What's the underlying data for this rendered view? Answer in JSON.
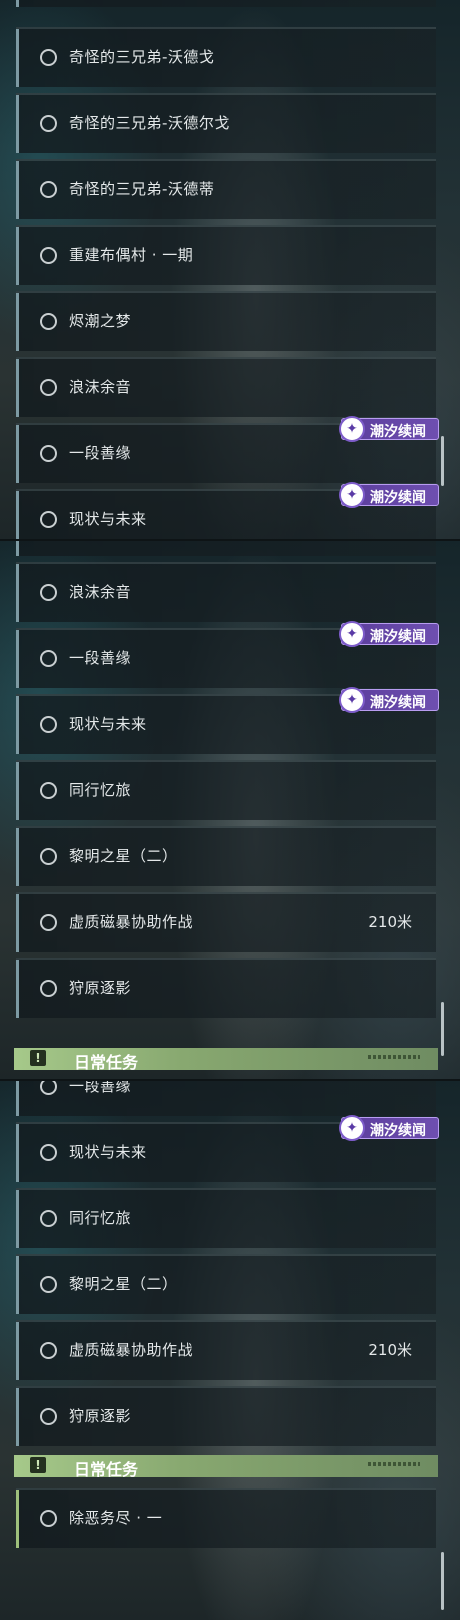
{
  "quests": {
    "wodego": "奇怪的三兄弟-沃德戈",
    "wodeerge": "奇怪的三兄弟-沃德尔戈",
    "wodedi": "奇怪的三兄弟-沃德蒂",
    "rebuild": "重建布偶村 · 一期",
    "dream": "烬潮之梦",
    "foam": "浪沫余音",
    "bond": "一段善缘",
    "future": "现状与未来",
    "journey": "同行忆旅",
    "dawn": "黎明之星（二）",
    "storm": "虚质磁暴协助作战",
    "hunt": "狩原逐影",
    "evil": "除恶务尽 · 一"
  },
  "storm_distance": "210米",
  "badge_text": "潮汐续闻",
  "daily_header": "日常任务",
  "icons": {
    "quest": "circle-outline-icon",
    "badge": "tidal-story-icon",
    "daily": "exclamation-icon"
  },
  "colors": {
    "badge": "#6e4fb0",
    "daily_header": "#a6c98a",
    "row_bar": "#7d9aa3"
  }
}
